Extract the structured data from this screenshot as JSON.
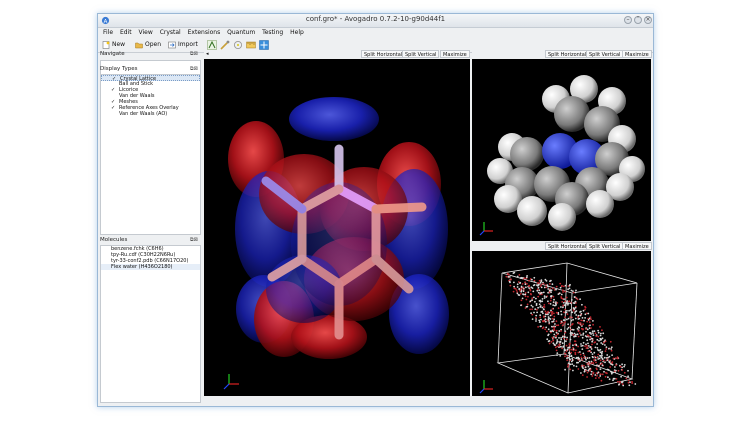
{
  "window": {
    "title": "conf.gro* - Avogadro 0.7.2-10-g90d44f1"
  },
  "menus": [
    "File",
    "Edit",
    "View",
    "Crystal",
    "Extensions",
    "Quantum",
    "Testing",
    "Help"
  ],
  "toolbar": {
    "new_label": "New",
    "open_label": "Open",
    "import_label": "Import",
    "tool_icons": [
      "draw-tool-icon",
      "navigate-tool-icon",
      "bond-centric-tool-icon",
      "measure-tool-icon",
      "select-tool-icon"
    ]
  },
  "navigate": {
    "title": "Navigate"
  },
  "display_types": {
    "title": "Display Types",
    "items": [
      {
        "label": "Crystal Lattice",
        "checked": true,
        "selected": true
      },
      {
        "label": "Ball and Stick",
        "checked": false
      },
      {
        "label": "Licorice",
        "checked": true
      },
      {
        "label": "Van der Waals",
        "checked": false
      },
      {
        "label": "Meshes",
        "checked": true
      },
      {
        "label": "Reference Axes Overlay",
        "checked": true
      },
      {
        "label": "Van der Waals (AO)",
        "checked": false
      }
    ]
  },
  "molecules": {
    "title": "Molecules",
    "items": [
      "benzene.fchk (C6H6)",
      "tpy-Ru.cdf (C30H22N6Ru)",
      "tyr-33-conf2.pdb (C66N17O20)",
      "Flex water (H436O2180)"
    ]
  },
  "view_header": {
    "split_horizontal": "Split Horizontal",
    "split_vertical": "Split Vertical",
    "maximize": "Maximize",
    "arrow": "◂"
  },
  "colors": {
    "orbital_red": "#b3121a",
    "orbital_blue": "#1d25c8",
    "accent": "#3e6fb0"
  }
}
